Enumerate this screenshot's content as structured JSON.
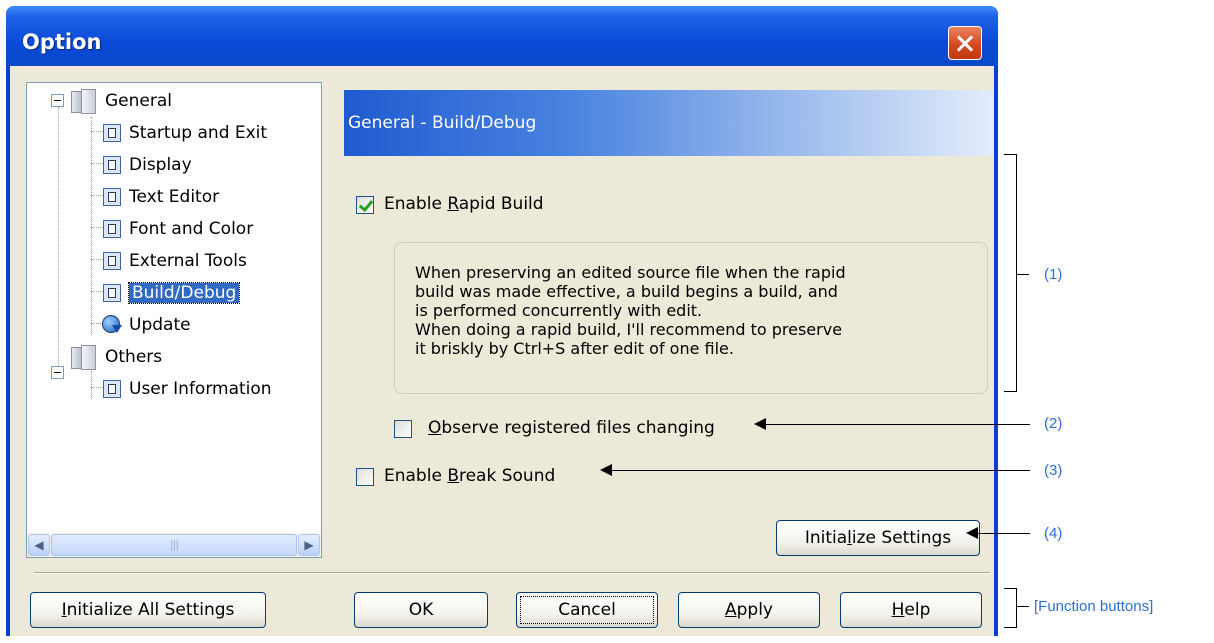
{
  "window": {
    "title": "Option"
  },
  "tree": {
    "nodes": [
      {
        "label": "General"
      },
      {
        "label": "Startup and Exit"
      },
      {
        "label": "Display"
      },
      {
        "label": "Text Editor"
      },
      {
        "label": "Font and Color"
      },
      {
        "label": "External Tools"
      },
      {
        "label": "Build/Debug",
        "selected": true
      },
      {
        "label": "Update"
      },
      {
        "label": "Others"
      },
      {
        "label": "User Information"
      }
    ]
  },
  "panel": {
    "header": "General - Build/Debug",
    "rapid_build": {
      "pre": "Enable ",
      "key": "R",
      "post": "apid Build",
      "checked": true
    },
    "description": "When preserving an edited source file when the rapid\nbuild was made effective, a build begins a build, and\nis performed concurrently with edit.\nWhen doing a rapid build, I'll recommend to preserve\nit briskly by Ctrl+S after edit of one file.",
    "observe": {
      "key": "O",
      "post": "bserve registered files changing",
      "checked": false
    },
    "break_sound": {
      "pre": "Enable ",
      "key": "B",
      "post": "reak Sound",
      "checked": false
    },
    "init_settings": {
      "pre": "Initia",
      "key": "l",
      "post": "ize Settings"
    }
  },
  "buttons": {
    "init_all": {
      "key": "I",
      "post": "nitialize All Settings"
    },
    "ok": "OK",
    "cancel": "Cancel",
    "apply": {
      "key": "A",
      "post": "pply"
    },
    "help": {
      "key": "H",
      "post": "elp"
    }
  },
  "annotations": {
    "a1": "(1)",
    "a2": "(2)",
    "a3": "(3)",
    "a4": "(4)",
    "function_buttons": "[Function buttons]"
  },
  "colors": {
    "titlebar": "#0a4ad8",
    "dialog_bg": "#ece9d8",
    "selection": "#316ac5",
    "annotation": "#2e6fd4"
  }
}
